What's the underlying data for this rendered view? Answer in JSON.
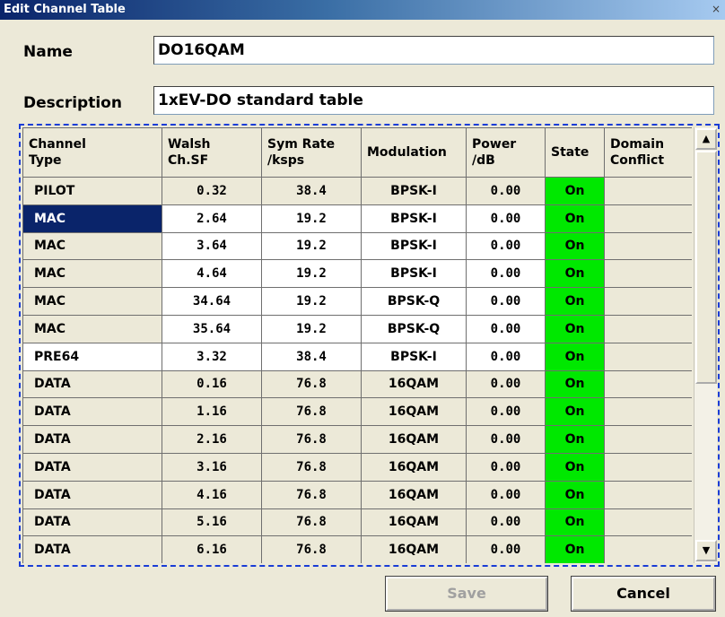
{
  "window": {
    "title": "Edit Channel Table",
    "close_glyph": "×"
  },
  "form": {
    "name_label": "Name",
    "name_value": "DO16QAM",
    "description_label": "Description",
    "description_value": "1xEV-DO standard table"
  },
  "table": {
    "columns": [
      {
        "line1": "Channel",
        "line2": "Type"
      },
      {
        "line1": "Walsh",
        "line2": "Ch.SF"
      },
      {
        "line1": "Sym Rate",
        "line2": "/ksps"
      },
      {
        "line1": "Modulation",
        "line2": ""
      },
      {
        "line1": "Power",
        "line2": "/dB"
      },
      {
        "line1": "State",
        "line2": ""
      },
      {
        "line1": "Domain",
        "line2": "Conflict"
      }
    ],
    "rows": [
      {
        "type": "PILOT",
        "walsh": "0.32",
        "rate": "38.4",
        "mod": "BPSK-I",
        "power": "0.00",
        "state": "On",
        "conflict": ""
      },
      {
        "type": "MAC",
        "walsh": "2.64",
        "rate": "19.2",
        "mod": "BPSK-I",
        "power": "0.00",
        "state": "On",
        "conflict": ""
      },
      {
        "type": "MAC",
        "walsh": "3.64",
        "rate": "19.2",
        "mod": "BPSK-I",
        "power": "0.00",
        "state": "On",
        "conflict": ""
      },
      {
        "type": "MAC",
        "walsh": "4.64",
        "rate": "19.2",
        "mod": "BPSK-I",
        "power": "0.00",
        "state": "On",
        "conflict": ""
      },
      {
        "type": "MAC",
        "walsh": "34.64",
        "rate": "19.2",
        "mod": "BPSK-Q",
        "power": "0.00",
        "state": "On",
        "conflict": ""
      },
      {
        "type": "MAC",
        "walsh": "35.64",
        "rate": "19.2",
        "mod": "BPSK-Q",
        "power": "0.00",
        "state": "On",
        "conflict": ""
      },
      {
        "type": "PRE64",
        "walsh": "3.32",
        "rate": "38.4",
        "mod": "BPSK-I",
        "power": "0.00",
        "state": "On",
        "conflict": ""
      },
      {
        "type": "DATA",
        "walsh": "0.16",
        "rate": "76.8",
        "mod": "16QAM",
        "power": "0.00",
        "state": "On",
        "conflict": ""
      },
      {
        "type": "DATA",
        "walsh": "1.16",
        "rate": "76.8",
        "mod": "16QAM",
        "power": "0.00",
        "state": "On",
        "conflict": ""
      },
      {
        "type": "DATA",
        "walsh": "2.16",
        "rate": "76.8",
        "mod": "16QAM",
        "power": "0.00",
        "state": "On",
        "conflict": ""
      },
      {
        "type": "DATA",
        "walsh": "3.16",
        "rate": "76.8",
        "mod": "16QAM",
        "power": "0.00",
        "state": "On",
        "conflict": ""
      },
      {
        "type": "DATA",
        "walsh": "4.16",
        "rate": "76.8",
        "mod": "16QAM",
        "power": "0.00",
        "state": "On",
        "conflict": ""
      },
      {
        "type": "DATA",
        "walsh": "5.16",
        "rate": "76.8",
        "mod": "16QAM",
        "power": "0.00",
        "state": "On",
        "conflict": ""
      },
      {
        "type": "DATA",
        "walsh": "6.16",
        "rate": "76.8",
        "mod": "16QAM",
        "power": "0.00",
        "state": "On",
        "conflict": ""
      },
      {
        "type": "",
        "walsh": "",
        "rate": "",
        "mod": "",
        "power": "",
        "state": "",
        "conflict": ""
      }
    ],
    "selected_row": 1,
    "white_type_rows": [
      6
    ],
    "state_on_color": "#00e800",
    "selection_color": "#0a246a"
  },
  "scrollbar": {
    "up_icon": "scroll-up-arrow",
    "down_icon": "scroll-down-arrow",
    "up_glyph": "▲",
    "down_glyph": "▼"
  },
  "buttons": {
    "save_label": "Save",
    "cancel_label": "Cancel"
  }
}
